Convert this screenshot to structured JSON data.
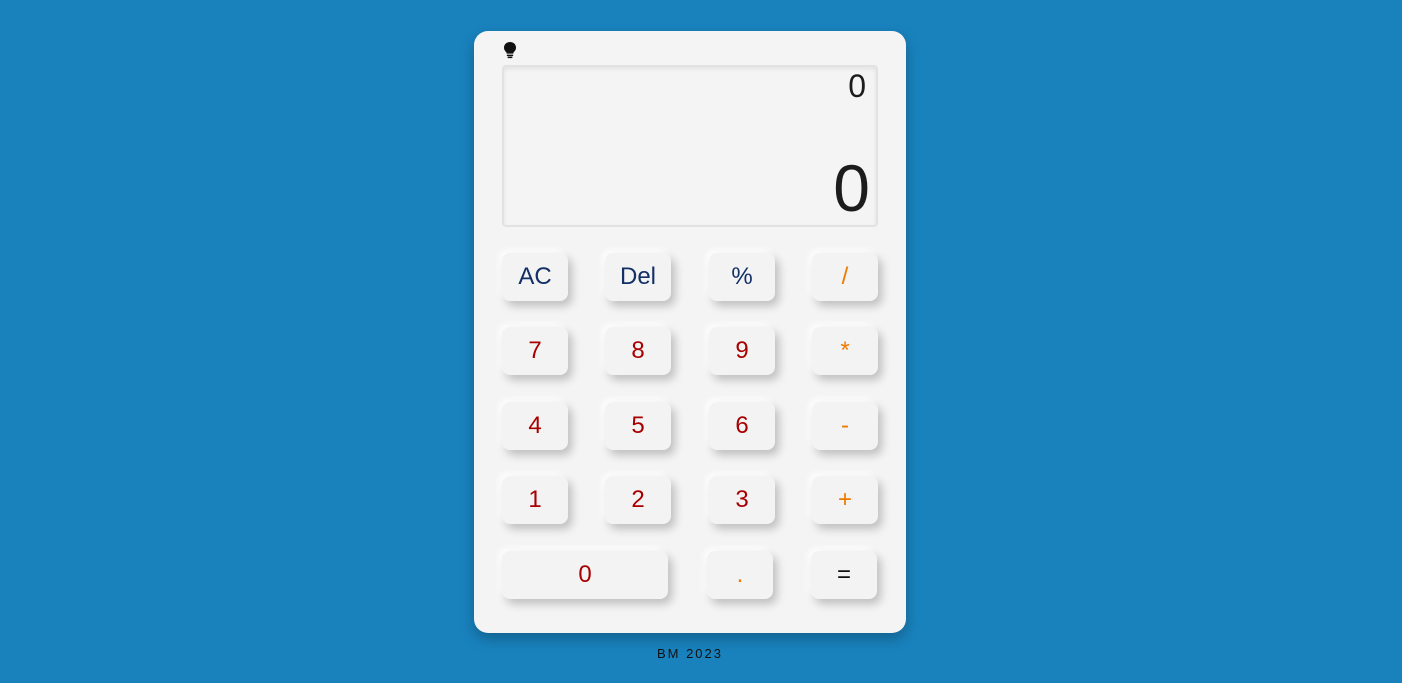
{
  "display": {
    "previous": "0",
    "current": "0"
  },
  "theme_toggle": {
    "icon": "lightbulb-icon"
  },
  "keys": {
    "ac": "AC",
    "del": "Del",
    "percent": "%",
    "divide": "/",
    "seven": "7",
    "eight": "8",
    "nine": "9",
    "multiply": "*",
    "four": "4",
    "five": "5",
    "six": "6",
    "minus": "-",
    "one": "1",
    "two": "2",
    "three": "3",
    "plus": "+",
    "zero": "0",
    "dot": ".",
    "equals": "="
  },
  "footer": {
    "text": "BM 2023"
  },
  "colors": {
    "background": "#1982bd",
    "function_keys": "#122f66",
    "number_keys": "#a80000",
    "operator_keys": "#f07a00"
  }
}
